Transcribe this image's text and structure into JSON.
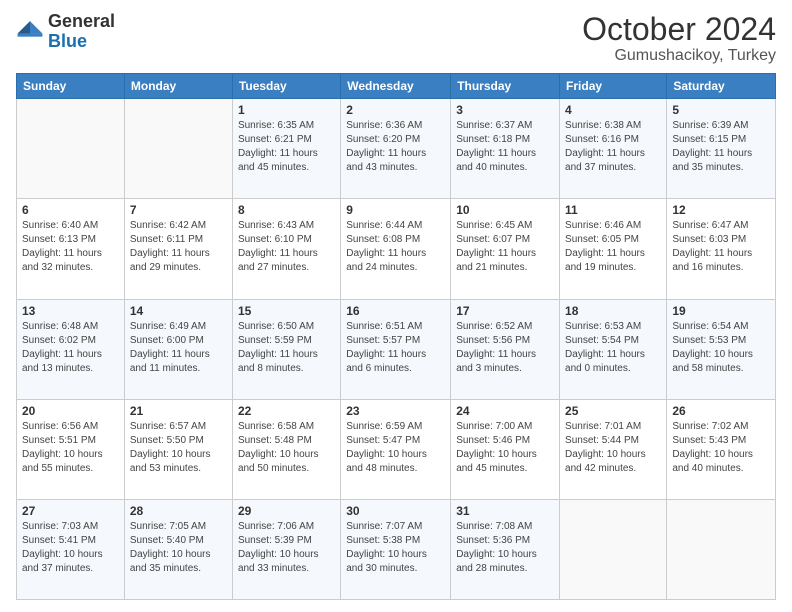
{
  "header": {
    "logo_general": "General",
    "logo_blue": "Blue",
    "month_title": "October 2024",
    "location": "Gumushacikoy, Turkey"
  },
  "columns": [
    "Sunday",
    "Monday",
    "Tuesday",
    "Wednesday",
    "Thursday",
    "Friday",
    "Saturday"
  ],
  "weeks": [
    [
      {
        "day": "",
        "info": ""
      },
      {
        "day": "",
        "info": ""
      },
      {
        "day": "1",
        "info": "Sunrise: 6:35 AM\nSunset: 6:21 PM\nDaylight: 11 hours and 45 minutes."
      },
      {
        "day": "2",
        "info": "Sunrise: 6:36 AM\nSunset: 6:20 PM\nDaylight: 11 hours and 43 minutes."
      },
      {
        "day": "3",
        "info": "Sunrise: 6:37 AM\nSunset: 6:18 PM\nDaylight: 11 hours and 40 minutes."
      },
      {
        "day": "4",
        "info": "Sunrise: 6:38 AM\nSunset: 6:16 PM\nDaylight: 11 hours and 37 minutes."
      },
      {
        "day": "5",
        "info": "Sunrise: 6:39 AM\nSunset: 6:15 PM\nDaylight: 11 hours and 35 minutes."
      }
    ],
    [
      {
        "day": "6",
        "info": "Sunrise: 6:40 AM\nSunset: 6:13 PM\nDaylight: 11 hours and 32 minutes."
      },
      {
        "day": "7",
        "info": "Sunrise: 6:42 AM\nSunset: 6:11 PM\nDaylight: 11 hours and 29 minutes."
      },
      {
        "day": "8",
        "info": "Sunrise: 6:43 AM\nSunset: 6:10 PM\nDaylight: 11 hours and 27 minutes."
      },
      {
        "day": "9",
        "info": "Sunrise: 6:44 AM\nSunset: 6:08 PM\nDaylight: 11 hours and 24 minutes."
      },
      {
        "day": "10",
        "info": "Sunrise: 6:45 AM\nSunset: 6:07 PM\nDaylight: 11 hours and 21 minutes."
      },
      {
        "day": "11",
        "info": "Sunrise: 6:46 AM\nSunset: 6:05 PM\nDaylight: 11 hours and 19 minutes."
      },
      {
        "day": "12",
        "info": "Sunrise: 6:47 AM\nSunset: 6:03 PM\nDaylight: 11 hours and 16 minutes."
      }
    ],
    [
      {
        "day": "13",
        "info": "Sunrise: 6:48 AM\nSunset: 6:02 PM\nDaylight: 11 hours and 13 minutes."
      },
      {
        "day": "14",
        "info": "Sunrise: 6:49 AM\nSunset: 6:00 PM\nDaylight: 11 hours and 11 minutes."
      },
      {
        "day": "15",
        "info": "Sunrise: 6:50 AM\nSunset: 5:59 PM\nDaylight: 11 hours and 8 minutes."
      },
      {
        "day": "16",
        "info": "Sunrise: 6:51 AM\nSunset: 5:57 PM\nDaylight: 11 hours and 6 minutes."
      },
      {
        "day": "17",
        "info": "Sunrise: 6:52 AM\nSunset: 5:56 PM\nDaylight: 11 hours and 3 minutes."
      },
      {
        "day": "18",
        "info": "Sunrise: 6:53 AM\nSunset: 5:54 PM\nDaylight: 11 hours and 0 minutes."
      },
      {
        "day": "19",
        "info": "Sunrise: 6:54 AM\nSunset: 5:53 PM\nDaylight: 10 hours and 58 minutes."
      }
    ],
    [
      {
        "day": "20",
        "info": "Sunrise: 6:56 AM\nSunset: 5:51 PM\nDaylight: 10 hours and 55 minutes."
      },
      {
        "day": "21",
        "info": "Sunrise: 6:57 AM\nSunset: 5:50 PM\nDaylight: 10 hours and 53 minutes."
      },
      {
        "day": "22",
        "info": "Sunrise: 6:58 AM\nSunset: 5:48 PM\nDaylight: 10 hours and 50 minutes."
      },
      {
        "day": "23",
        "info": "Sunrise: 6:59 AM\nSunset: 5:47 PM\nDaylight: 10 hours and 48 minutes."
      },
      {
        "day": "24",
        "info": "Sunrise: 7:00 AM\nSunset: 5:46 PM\nDaylight: 10 hours and 45 minutes."
      },
      {
        "day": "25",
        "info": "Sunrise: 7:01 AM\nSunset: 5:44 PM\nDaylight: 10 hours and 42 minutes."
      },
      {
        "day": "26",
        "info": "Sunrise: 7:02 AM\nSunset: 5:43 PM\nDaylight: 10 hours and 40 minutes."
      }
    ],
    [
      {
        "day": "27",
        "info": "Sunrise: 7:03 AM\nSunset: 5:41 PM\nDaylight: 10 hours and 37 minutes."
      },
      {
        "day": "28",
        "info": "Sunrise: 7:05 AM\nSunset: 5:40 PM\nDaylight: 10 hours and 35 minutes."
      },
      {
        "day": "29",
        "info": "Sunrise: 7:06 AM\nSunset: 5:39 PM\nDaylight: 10 hours and 33 minutes."
      },
      {
        "day": "30",
        "info": "Sunrise: 7:07 AM\nSunset: 5:38 PM\nDaylight: 10 hours and 30 minutes."
      },
      {
        "day": "31",
        "info": "Sunrise: 7:08 AM\nSunset: 5:36 PM\nDaylight: 10 hours and 28 minutes."
      },
      {
        "day": "",
        "info": ""
      },
      {
        "day": "",
        "info": ""
      }
    ]
  ]
}
